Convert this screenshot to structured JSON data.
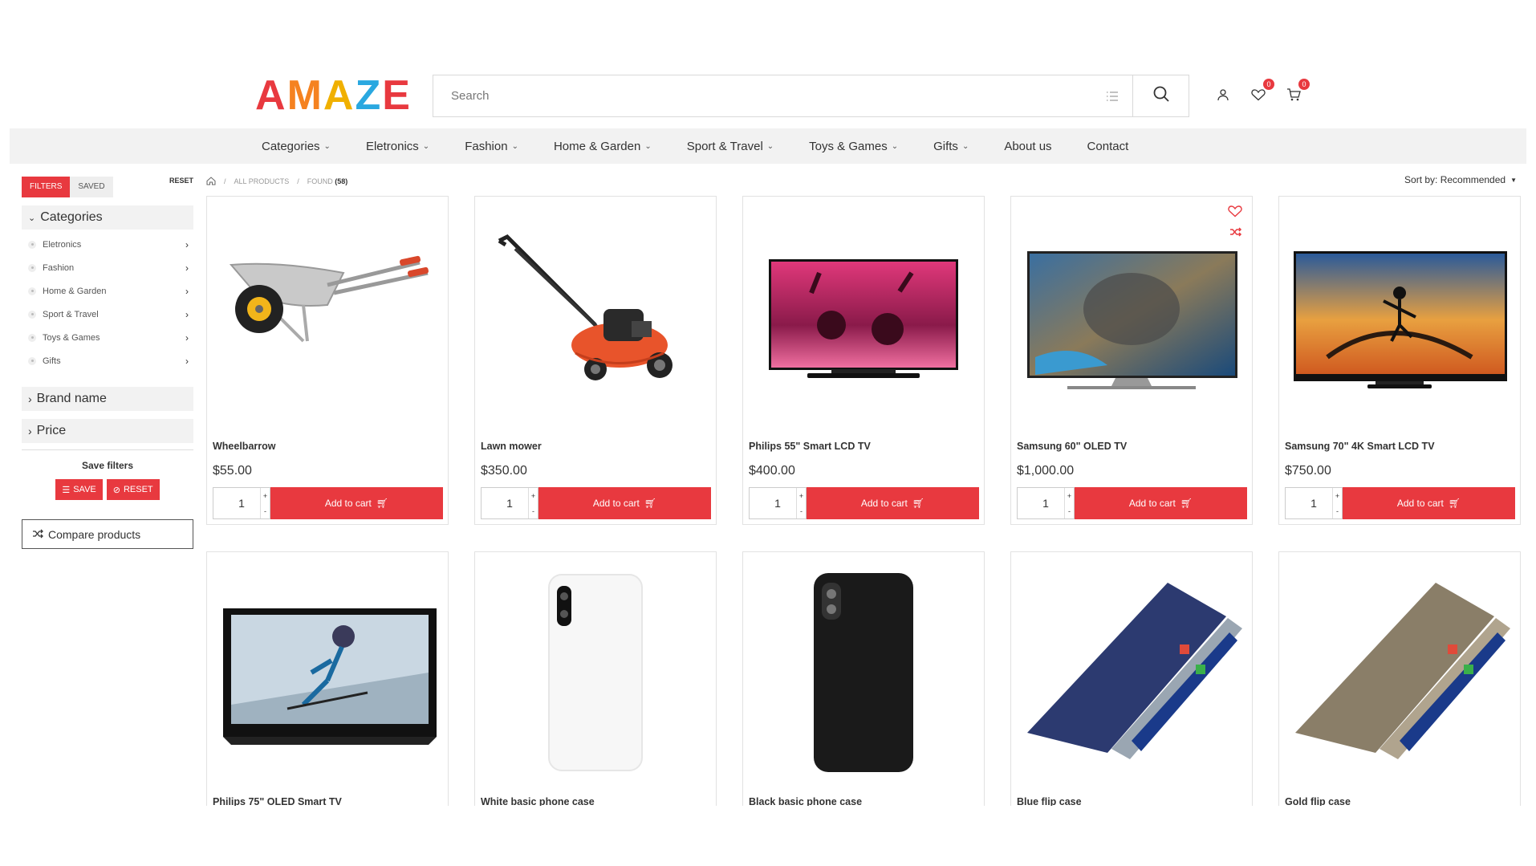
{
  "header": {
    "logo_letters": [
      "A",
      "M",
      "A",
      "Z",
      "E"
    ],
    "logo_colors": [
      "#e8393f",
      "#f58220",
      "#ffc20e",
      "#2aa8e0",
      "#e8393f"
    ],
    "search_placeholder": "Search",
    "wishlist_count": "0",
    "cart_count": "0"
  },
  "nav": {
    "items": [
      {
        "label": "Categories",
        "dropdown": true
      },
      {
        "label": "Eletronics",
        "dropdown": true
      },
      {
        "label": "Fashion",
        "dropdown": true
      },
      {
        "label": "Home & Garden",
        "dropdown": true
      },
      {
        "label": "Sport & Travel",
        "dropdown": true
      },
      {
        "label": "Toys & Games",
        "dropdown": true
      },
      {
        "label": "Gifts",
        "dropdown": true
      },
      {
        "label": "About us",
        "dropdown": false
      },
      {
        "label": "Contact",
        "dropdown": false
      }
    ]
  },
  "sidebar": {
    "tab_filters": "Filters",
    "tab_saved": "Saved",
    "reset_link": "Reset",
    "categories_heading": "Categories",
    "categories": [
      "Eletronics",
      "Fashion",
      "Home & Garden",
      "Sport & Travel",
      "Toys & Games",
      "Gifts"
    ],
    "brand_heading": "Brand name",
    "price_heading": "Price",
    "save_filters_title": "Save filters",
    "save_button": "Save",
    "reset_button": "Reset",
    "compare_label": "Compare products"
  },
  "breadcrumb": {
    "all_products": "All products",
    "found_label": "Found",
    "found_count": "(58)"
  },
  "sort": {
    "label": "Sort by: Recommended"
  },
  "colors": {
    "accent": "#e8393f"
  },
  "products": [
    {
      "name": "Wheelbarrow",
      "price": "$55.00",
      "qty": "1",
      "cart_label": "Add to cart",
      "image": "wheelbarrow"
    },
    {
      "name": "Lawn mower",
      "price": "$350.00",
      "qty": "1",
      "cart_label": "Add to cart",
      "image": "lawnmower"
    },
    {
      "name": "Philips 55\" Smart LCD TV",
      "price": "$400.00",
      "qty": "1",
      "cart_label": "Add to cart",
      "image": "tv-concert"
    },
    {
      "name": "Samsung 60\" OLED TV",
      "price": "$1,000.00",
      "qty": "1",
      "cart_label": "Add to cart",
      "image": "tv-earth"
    },
    {
      "name": "Samsung 70\" 4K Smart LCD TV",
      "price": "$750.00",
      "qty": "1",
      "cart_label": "Add to cart",
      "image": "tv-skate"
    },
    {
      "name": "Philips 75\" OLED Smart TV",
      "image": "tv-scooter"
    },
    {
      "name": "White basic phone case",
      "image": "case-white"
    },
    {
      "name": "Black basic phone case",
      "image": "case-black"
    },
    {
      "name": "Blue flip case",
      "image": "flip-blue"
    },
    {
      "name": "Gold flip case",
      "image": "flip-gold"
    }
  ]
}
